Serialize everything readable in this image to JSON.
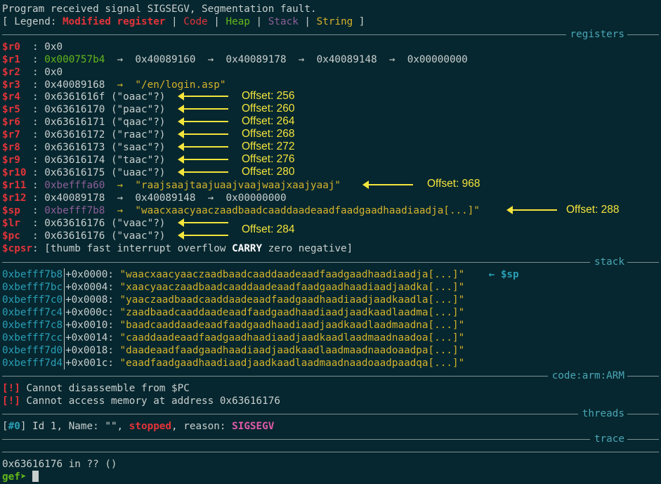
{
  "header": {
    "signal_msg": "Program received signal SIGSEGV, Segmentation fault.",
    "legend_prefix": "[ Legend: ",
    "legend_modified": "Modified register",
    "legend_sep": " | ",
    "legend_code": "Code",
    "legend_heap": "Heap",
    "legend_stack": "Stack",
    "legend_string": "String",
    "legend_suffix": " ]"
  },
  "sections": {
    "registers": "registers",
    "stack": "stack",
    "code": "code:arm:ARM",
    "threads": "threads",
    "trace": "trace"
  },
  "registers": [
    {
      "name": "$r0",
      "pre": "  : ",
      "a": "0x0",
      "b": ""
    },
    {
      "name": "$r1",
      "pre": "  : ",
      "a": "0x000757b4",
      "b": "  →  0x40089160  →  0x40089178  →  0x40089148  →  0x00000000"
    },
    {
      "name": "$r2",
      "pre": "  : ",
      "a": "0x0",
      "b": ""
    },
    {
      "name": "$r3",
      "pre": "  : ",
      "a": "0x40089168",
      "b": "  →  \"/en/login.asp\""
    },
    {
      "name": "$r4",
      "pre": "  : ",
      "a": "0x6361616f",
      "b": " (\"oaac\"?)"
    },
    {
      "name": "$r5",
      "pre": "  : ",
      "a": "0x63616170",
      "b": " (\"paac\"?)"
    },
    {
      "name": "$r6",
      "pre": "  : ",
      "a": "0x63616171",
      "b": " (\"qaac\"?)"
    },
    {
      "name": "$r7",
      "pre": "  : ",
      "a": "0x63616172",
      "b": " (\"raac\"?)"
    },
    {
      "name": "$r8",
      "pre": "  : ",
      "a": "0x63616173",
      "b": " (\"saac\"?)"
    },
    {
      "name": "$r9",
      "pre": "  : ",
      "a": "0x63616174",
      "b": " (\"taac\"?)"
    },
    {
      "name": "$r10",
      "pre": " : ",
      "a": "0x63616175",
      "b": " (\"uaac\"?)"
    },
    {
      "name": "$r11",
      "pre": " : ",
      "a": "0xbefffa60",
      "b": "  →  \"raajsaajtaajuaajvaajwaajxaajyaaj\""
    },
    {
      "name": "$r12",
      "pre": " : ",
      "a": "0x40089178",
      "b": "  →  0x40089148  →  0x00000000"
    },
    {
      "name": "$sp",
      "pre": "  : ",
      "a": "0xbefff7b8",
      "b": "  →  \"waacxaacyaaczaadbaadcaaddaadeaadfaadgaadhaadiaadja[...]\""
    },
    {
      "name": "$lr",
      "pre": "  : ",
      "a": "0x63616176",
      "b": " (\"vaac\"?)"
    },
    {
      "name": "$pc",
      "pre": "  : ",
      "a": "0x63616176",
      "b": " (\"vaac\"?)"
    },
    {
      "name": "$cpsr",
      "pre": ": ",
      "a": "[thumb fast interrupt overflow ",
      "carry": "CARRY",
      "b": " zero negative]"
    }
  ],
  "annotations": [
    "Offset: 256",
    "Offset: 260",
    "Offset: 264",
    "Offset: 268",
    "Offset: 272",
    "Offset: 276",
    "Offset: 280",
    "Offset: 968",
    "Offset: 288",
    "Offset: 284"
  ],
  "stack": [
    {
      "addr": "0xbefff7b8",
      "off": "+0x0000: ",
      "val": "\"waacxaacyaaczaadbaadcaaddaadeaadfaadgaadhaadiaadja[...]\"",
      "note": "← $sp"
    },
    {
      "addr": "0xbefff7bc",
      "off": "+0x0004: ",
      "val": "\"xaacyaaczaadbaadcaaddaadeaadfaadgaadhaadiaadjaadka[...]\"",
      "note": ""
    },
    {
      "addr": "0xbefff7c0",
      "off": "+0x0008: ",
      "val": "\"yaaczaadbaadcaaddaadeaadfaadgaadhaadiaadjaadkaadla[...]\"",
      "note": ""
    },
    {
      "addr": "0xbefff7c4",
      "off": "+0x000c: ",
      "val": "\"zaadbaadcaaddaadeaadfaadgaadhaadiaadjaadkaadlaadma[...]\"",
      "note": ""
    },
    {
      "addr": "0xbefff7c8",
      "off": "+0x0010: ",
      "val": "\"baadcaaddaadeaadfaadgaadhaadiaadjaadkaadlaadmaadna[...]\"",
      "note": ""
    },
    {
      "addr": "0xbefff7cc",
      "off": "+0x0014: ",
      "val": "\"caaddaadeaadfaadgaadhaadiaadjaadkaadlaadmaadnaadoa[...]\"",
      "note": ""
    },
    {
      "addr": "0xbefff7d0",
      "off": "+0x0018: ",
      "val": "\"daadeaadfaadgaadhaadiaadjaadkaadlaadmaadnaadoaadpa[...]\"",
      "note": ""
    },
    {
      "addr": "0xbefff7d4",
      "off": "+0x001c: ",
      "val": "\"eaadfaadgaadhaadiaadjaadkaadlaadmaadnaadoaadpaadqa[...]\"",
      "note": ""
    }
  ],
  "code": {
    "bang": "[!]",
    "err1": " Cannot disassemble from $PC",
    "err2": " Cannot access memory at address 0x63616176"
  },
  "threads": {
    "open": "[",
    "num": "#0",
    "mid": "] Id 1, Name: \"\", ",
    "state": "stopped",
    "reason_label": ", reason: ",
    "reason": "SIGSEGV"
  },
  "trace": {
    "frame": "0x63616176 in ?? ()"
  },
  "prompt": {
    "text": "gef➤ "
  }
}
